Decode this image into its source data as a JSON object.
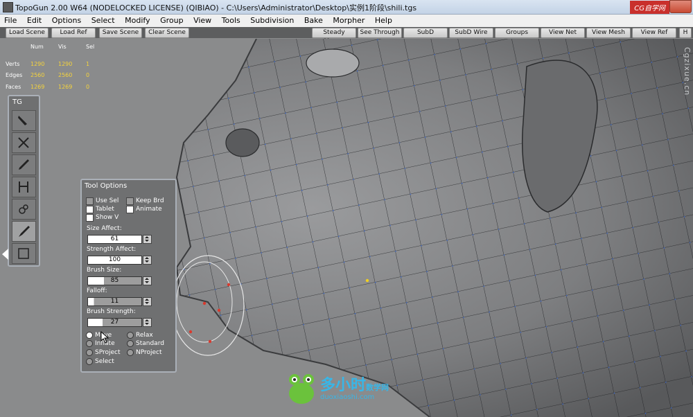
{
  "window": {
    "title": "TopoGun 2.00 W64  (NODELOCKED LICENSE) (QIBIAO) - C:\\Users\\Administrator\\Desktop\\实例1阶段\\shili.tgs",
    "brand": "CG自学网"
  },
  "menu": [
    "File",
    "Edit",
    "Options",
    "Select",
    "Modify",
    "Group",
    "View",
    "Tools",
    "Subdivision",
    "Bake",
    "Morpher",
    "Help"
  ],
  "toolbar": {
    "load_scene": "Load Scene",
    "load_ref": "Load Ref",
    "save_scene": "Save Scene",
    "clear_scene": "Clear Scene",
    "steady_mouse": "Steady Mouse",
    "see_through": "See Through",
    "subd": "SubD",
    "subd_wire": "SubD Wire",
    "groups": "Groups",
    "view_net": "View Net",
    "view_mesh": "View Mesh",
    "view_ref": "View Ref",
    "more": "H"
  },
  "stats": {
    "headers": {
      "num": "Num",
      "vis": "Vis",
      "sel": "Sel"
    },
    "verts": {
      "label": "Verts",
      "num": "1290",
      "vis": "1290",
      "sel": "1"
    },
    "edges": {
      "label": "Edges",
      "num": "2560",
      "vis": "2560",
      "sel": "0"
    },
    "faces": {
      "label": "Faces",
      "num": "1269",
      "vis": "1269",
      "sel": "0"
    }
  },
  "tg_panel": {
    "title": "TG",
    "tools": [
      "pen-icon",
      "cross-icon",
      "pencil-icon",
      "bridge-icon",
      "brush-icon",
      "smooth-brush-icon",
      "select-box-icon"
    ]
  },
  "tool_options": {
    "title": "Tool Options",
    "use_sel": "Use Sel",
    "keep_brd": "Keep Brd",
    "tablet": "Tablet",
    "animate": "Animate",
    "show_v": "Show V",
    "size_affect_label": "Size Affect:",
    "size_affect": "61",
    "strength_affect_label": "Strength Affect:",
    "strength_affect": "100",
    "brush_size_label": "Brush Size:",
    "brush_size": "85",
    "falloff_label": "Falloff:",
    "falloff": "11",
    "brush_strength_label": "Brush Strength:",
    "brush_strength": "27",
    "modes": {
      "move": "Move",
      "relax": "Relax",
      "inflate": "Inflate",
      "standard": "Standard",
      "sproject": "SProject",
      "nproject": "NProject",
      "select": "Select"
    }
  },
  "watermarks": {
    "side": "Cgzixue.cn",
    "logo": "多小时",
    "logo_sub": "数学网",
    "url": "duoxiaoshi.com"
  }
}
